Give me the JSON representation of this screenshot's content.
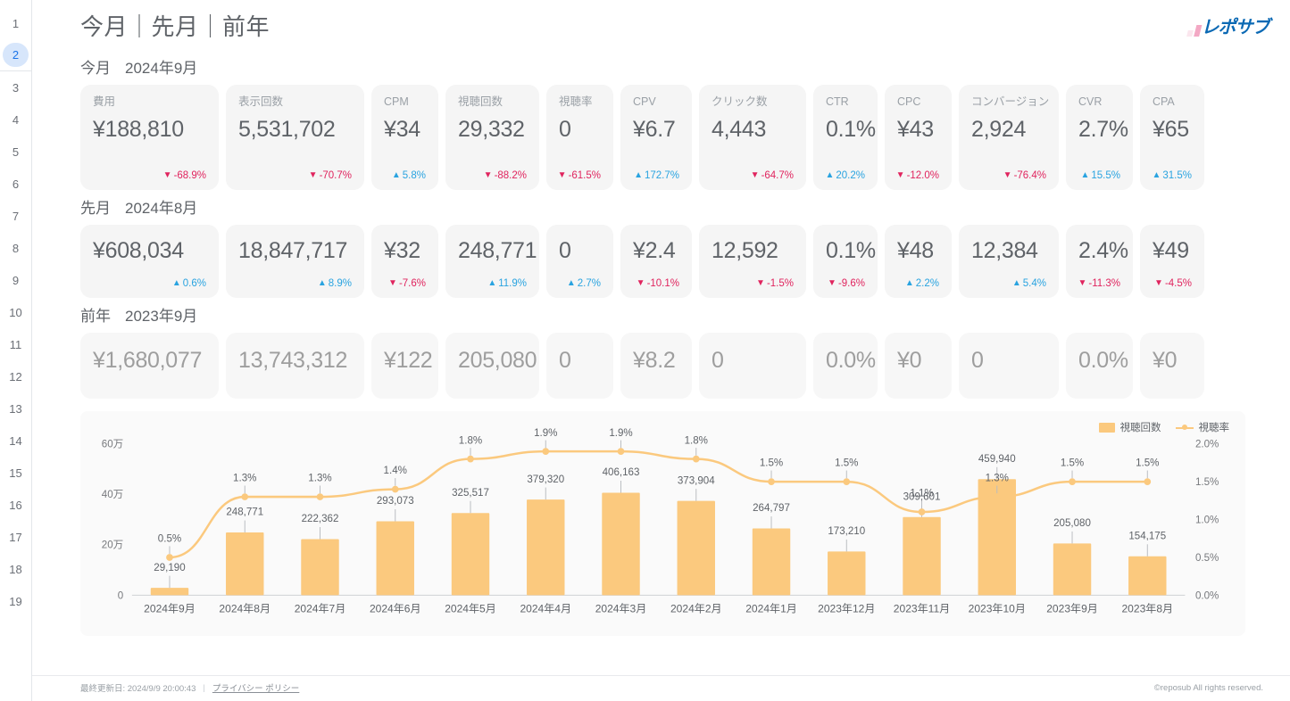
{
  "header": {
    "title": "今月｜先月｜前年",
    "logo_text": "レポサブ"
  },
  "gutter": {
    "items": [
      "1",
      "2",
      "3",
      "4",
      "5",
      "6",
      "7",
      "8",
      "9",
      "10",
      "11",
      "12",
      "13",
      "14",
      "15",
      "16",
      "17",
      "18",
      "19"
    ],
    "active": "2"
  },
  "metrics": {
    "labels": [
      "費用",
      "表示回数",
      "CPM",
      "視聴回数",
      "視聴率",
      "CPV",
      "クリック数",
      "CTR",
      "CPC",
      "コンバージョン",
      "CVR",
      "CPA"
    ]
  },
  "sections": [
    {
      "label": "今月",
      "period": "2024年9月",
      "values": [
        "¥188,810",
        "5,531,702",
        "¥34",
        "29,332",
        "0",
        "¥6.7",
        "4,443",
        "0.1%",
        "¥43",
        "2,924",
        "2.7%",
        "¥65"
      ],
      "deltas": [
        "-68.9%",
        "-70.7%",
        "5.8%",
        "-88.2%",
        "-61.5%",
        "172.7%",
        "-64.7%",
        "20.2%",
        "-12.0%",
        "-76.4%",
        "15.5%",
        "31.5%"
      ],
      "dirs": [
        "down",
        "down",
        "up",
        "down",
        "down",
        "up",
        "down",
        "up",
        "down",
        "down",
        "up",
        "up"
      ]
    },
    {
      "label": "先月",
      "period": "2024年8月",
      "values": [
        "¥608,034",
        "18,847,717",
        "¥32",
        "248,771",
        "0",
        "¥2.4",
        "12,592",
        "0.1%",
        "¥48",
        "12,384",
        "2.4%",
        "¥49"
      ],
      "deltas": [
        "0.6%",
        "8.9%",
        "-7.6%",
        "11.9%",
        "2.7%",
        "-10.1%",
        "-1.5%",
        "-9.6%",
        "2.2%",
        "5.4%",
        "-11.3%",
        "-4.5%"
      ],
      "dirs": [
        "up",
        "up",
        "down",
        "up",
        "up",
        "down",
        "down",
        "down",
        "up",
        "up",
        "down",
        "down"
      ]
    },
    {
      "label": "前年",
      "period": "2023年9月",
      "values": [
        "¥1,680,077",
        "13,743,312",
        "¥122",
        "205,080",
        "0",
        "¥8.2",
        "0",
        "0.0%",
        "¥0",
        "0",
        "0.0%",
        "¥0"
      ],
      "deltas": [],
      "dirs": []
    }
  ],
  "chart_data": {
    "type": "bar",
    "title": "",
    "legend": [
      "視聴回数",
      "視聴率"
    ],
    "legend_position": "top-right",
    "categories": [
      "2024年9月",
      "2024年8月",
      "2024年7月",
      "2024年6月",
      "2024年5月",
      "2024年4月",
      "2024年3月",
      "2024年2月",
      "2024年1月",
      "2023年12月",
      "2023年11月",
      "2023年10月",
      "2023年9月",
      "2023年8月"
    ],
    "series": [
      {
        "name": "視聴回数",
        "type": "bar",
        "axis": "left",
        "color": "#fbc97e",
        "values": [
          29190,
          248771,
          222362,
          293073,
          325517,
          379320,
          406163,
          373904,
          264797,
          173210,
          309601,
          459940,
          205080,
          154175
        ],
        "labels": [
          "29,190",
          "248,771",
          "222,362",
          "293,073",
          "325,517",
          "379,320",
          "406,163",
          "373,904",
          "264,797",
          "173,210",
          "309,601",
          "459,940",
          "205,080",
          "154,175"
        ]
      },
      {
        "name": "視聴率",
        "type": "line",
        "axis": "right",
        "color": "#fbc97e",
        "values": [
          0.5,
          1.3,
          1.3,
          1.4,
          1.8,
          1.9,
          1.9,
          1.8,
          1.5,
          1.5,
          1.1,
          1.3,
          1.5,
          1.5
        ],
        "labels": [
          "0.5%",
          "1.3%",
          "1.3%",
          "1.4%",
          "1.8%",
          "1.9%",
          "1.9%",
          "1.8%",
          "1.5%",
          "1.5%",
          "1.1%",
          "1.3%",
          "1.5%",
          "1.5%"
        ]
      }
    ],
    "y_left": {
      "ticks": [
        "0",
        "20万",
        "40万",
        "60万"
      ],
      "min": 0,
      "max": 600000
    },
    "y_right": {
      "ticks": [
        "0.0%",
        "0.5%",
        "1.0%",
        "1.5%",
        "2.0%"
      ],
      "min": 0,
      "max": 2.0
    },
    "grid": false
  },
  "footer": {
    "updated_label": "最終更新日: 2024/9/9 20:00:43",
    "separator": "|",
    "privacy_link": "プライバシー ポリシー",
    "copyright": "©reposub All rights reserved."
  }
}
